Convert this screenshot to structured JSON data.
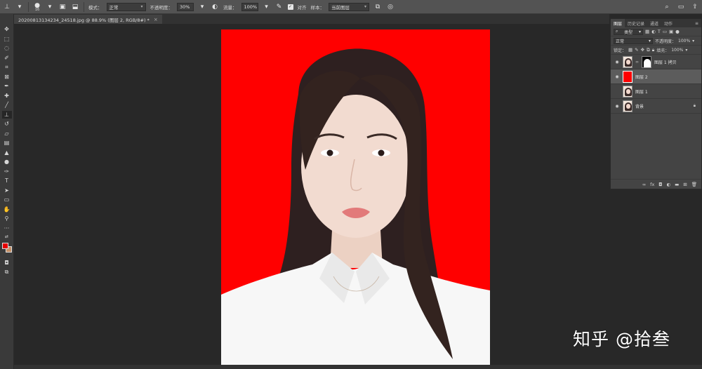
{
  "options_bar": {
    "brush_size": "16",
    "mode_label": "模式：",
    "mode_value": "正常",
    "opacity_label": "不透明度：",
    "opacity_value": "30%",
    "flow_label": "流量：",
    "flow_value": "100%",
    "aligned_label": "对齐",
    "sample_label": "样本：",
    "sample_value": "当前图层"
  },
  "document_tab": {
    "title": "20200813134234_24518.jpg @ 88.9% (图层 2, RGB/8#) *",
    "close": "×"
  },
  "toolbar": {
    "tools": [
      "move-tool",
      "marquee-tool",
      "lasso-tool",
      "quick-select-tool",
      "crop-tool",
      "frame-tool",
      "eyedropper-tool",
      "spot-heal-tool",
      "brush-tool",
      "clone-stamp-tool",
      "history-brush-tool",
      "eraser-tool",
      "gradient-tool",
      "blur-tool",
      "dodge-tool",
      "pen-tool",
      "type-tool",
      "path-select-tool",
      "rectangle-tool",
      "hand-tool",
      "zoom-tool",
      "more-tools"
    ],
    "active_tool": "clone-stamp-tool",
    "foreground_color": "#e60000",
    "background_color": "#c69066"
  },
  "layers_panel": {
    "tabs": [
      "图层",
      "历史记录",
      "通道",
      "动作"
    ],
    "filter_label": "类型",
    "blend_mode": "正常",
    "opacity_label": "不透明度：",
    "opacity_value": "100%",
    "lock_label": "锁定：",
    "fill_label": "填充：",
    "fill_value": "100%",
    "layers": [
      {
        "name": "图层 1 拷贝",
        "visible": true,
        "selected": false,
        "thumb": "portrait",
        "has_mask": true
      },
      {
        "name": "图层 2",
        "visible": true,
        "selected": true,
        "thumb": "red",
        "has_mask": false
      },
      {
        "name": "图层 1",
        "visible": false,
        "selected": false,
        "thumb": "portrait",
        "has_mask": false
      },
      {
        "name": "背景",
        "visible": true,
        "selected": false,
        "thumb": "portrait",
        "has_mask": false,
        "locked": true
      }
    ],
    "footer_icons": [
      "link-icon",
      "fx-icon",
      "add-mask-icon",
      "adjustment-icon",
      "group-icon",
      "new-layer-icon",
      "trash-icon"
    ]
  },
  "watermark": "知乎 @拾叁",
  "colors": {
    "canvas_background": "#ff0000",
    "workspace": "#282828",
    "panel": "#444444"
  }
}
